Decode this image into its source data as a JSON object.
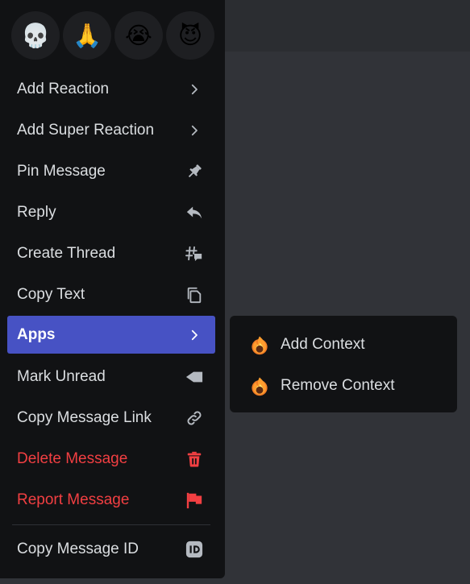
{
  "reactions": [
    {
      "emoji": "💀",
      "name": "skull"
    },
    {
      "emoji": "🙏",
      "name": "pray"
    },
    {
      "emoji": "😭",
      "name": "sob"
    },
    {
      "emoji": "😈",
      "name": "smiling-imp"
    }
  ],
  "menu": {
    "add_reaction": "Add Reaction",
    "add_super_reaction": "Add Super Reaction",
    "pin_message": "Pin Message",
    "reply": "Reply",
    "create_thread": "Create Thread",
    "copy_text": "Copy Text",
    "apps": "Apps",
    "mark_unread": "Mark Unread",
    "copy_message_link": "Copy Message Link",
    "delete_message": "Delete Message",
    "report_message": "Report Message",
    "copy_message_id": "Copy Message ID"
  },
  "submenu": {
    "add_context": "Add Context",
    "remove_context": "Remove Context"
  },
  "colors": {
    "accent": "#4752c4",
    "danger": "#f23f42",
    "menu_bg": "#111214",
    "text": "#dbdee1"
  }
}
